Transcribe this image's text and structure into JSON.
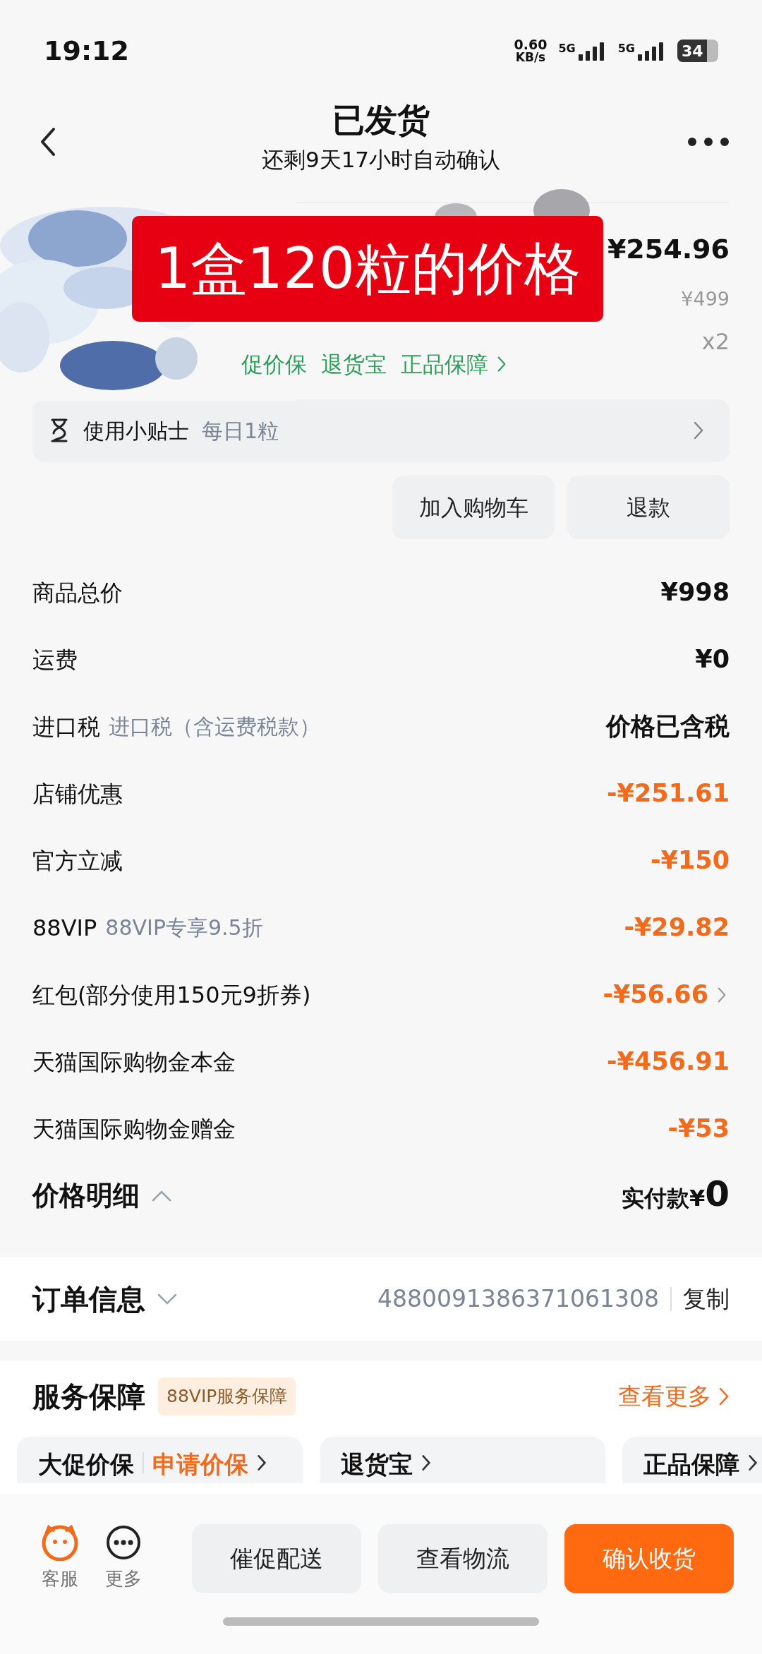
{
  "status_bar": {
    "time": "19:12",
    "net_speed": "0.60",
    "net_unit": "KB/s",
    "sim1": "5G",
    "sim2": "5G",
    "battery": "34"
  },
  "header": {
    "title": "已发货",
    "subtitle": "还剩9天17小时自动确认"
  },
  "product": {
    "kind": "picture",
    "overlay_label": "1盒120粒的价格",
    "price": "¥254.96",
    "original_price": "¥499",
    "quantity": "x2",
    "tags": [
      "促价保",
      "退货宝",
      "正品保障"
    ]
  },
  "tip": {
    "label": "使用小贴士",
    "value": "每日1粒"
  },
  "item_actions": [
    "加入购物车",
    "退款"
  ],
  "price_rows": [
    {
      "label": "商品总价",
      "value": "¥998",
      "kind": "plain",
      "chevron": false
    },
    {
      "label": "运费",
      "value": "¥0",
      "kind": "plain",
      "chevron": false
    },
    {
      "label": "进口税",
      "note": "进口税（含运费税款）",
      "value": "价格已含税",
      "kind": "plain",
      "chevron": false
    },
    {
      "label": "店铺优惠",
      "value": "-¥251.61",
      "kind": "discount",
      "chevron": false
    },
    {
      "label": "官方立减",
      "value": "-¥150",
      "kind": "discount",
      "chevron": false
    },
    {
      "label": "88VIP",
      "note": "88VIP专享9.5折",
      "value": "-¥29.82",
      "kind": "discount",
      "chevron": false
    },
    {
      "label": "红包(部分使用150元9折券)",
      "value": "-¥56.66",
      "kind": "discount",
      "chevron": true
    },
    {
      "label": "天猫国际购物金本金",
      "value": "-¥456.91",
      "kind": "discount",
      "chevron": false
    },
    {
      "label": "天猫国际购物金赠金",
      "value": "-¥53",
      "kind": "discount",
      "chevron": false
    }
  ],
  "price_summary": {
    "label": "价格明细",
    "expanded": true,
    "paid_label": "实付款¥",
    "paid_value": "0"
  },
  "order_info": {
    "label": "订单信息",
    "expanded": false,
    "order_number": "4880091386371061308",
    "copy": "复制"
  },
  "services": {
    "title": "服务保障",
    "badge": "88VIP服务保障",
    "more": "查看更多",
    "cards": [
      {
        "title": "大促价保",
        "action": "申请价保"
      },
      {
        "title": "退货宝"
      },
      {
        "title": "正品保障"
      }
    ]
  },
  "bottom_bar": {
    "icons": [
      {
        "label": "客服",
        "kind": "service"
      },
      {
        "label": "更多",
        "kind": "more"
      }
    ],
    "buttons": [
      {
        "label": "催促配送",
        "primary": false
      },
      {
        "label": "查看物流",
        "primary": false
      },
      {
        "label": "确认收货",
        "primary": true
      }
    ]
  }
}
